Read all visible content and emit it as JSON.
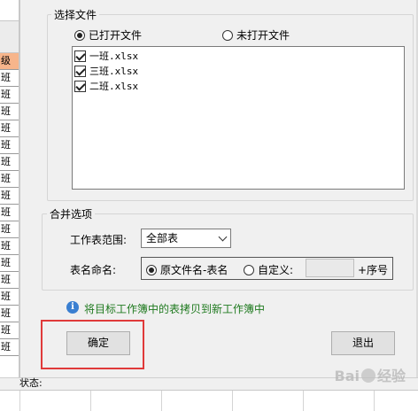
{
  "excel": {
    "cells": [
      "级",
      "班",
      "班",
      "班",
      "班",
      "班",
      "班",
      "班",
      "班",
      "班",
      "班",
      "班",
      "班",
      "班",
      "班",
      "班",
      "班",
      "班"
    ]
  },
  "dialog": {
    "select_files": {
      "title": "选择文件",
      "radio_opened": "已打开文件",
      "radio_unopened": "未打开文件",
      "selected": "radio_opened",
      "files": [
        {
          "name": "一班.xlsx",
          "checked": true
        },
        {
          "name": "三班.xlsx",
          "checked": true
        },
        {
          "name": "二班.xlsx",
          "checked": true
        }
      ]
    },
    "merge_options": {
      "title": "合并选项",
      "sheet_range_label": "工作表范围:",
      "sheet_range_value": "全部表",
      "sheet_naming_label": "表名命名:",
      "naming_original": "原文件名-表名",
      "naming_custom": "自定义:",
      "custom_value": "",
      "seq_label": "+序号",
      "selected": "naming_original"
    },
    "info_text": "将目标工作簿中的表拷贝到新工作簿中",
    "confirm_label": "确定",
    "exit_label": "退出"
  },
  "status": {
    "label": "状态:"
  },
  "colors": {
    "accent_info": "#3a7fd1",
    "info_text": "#1f7a1f",
    "highlight": "#e03a3a",
    "excel_header": "#f7b58b"
  }
}
